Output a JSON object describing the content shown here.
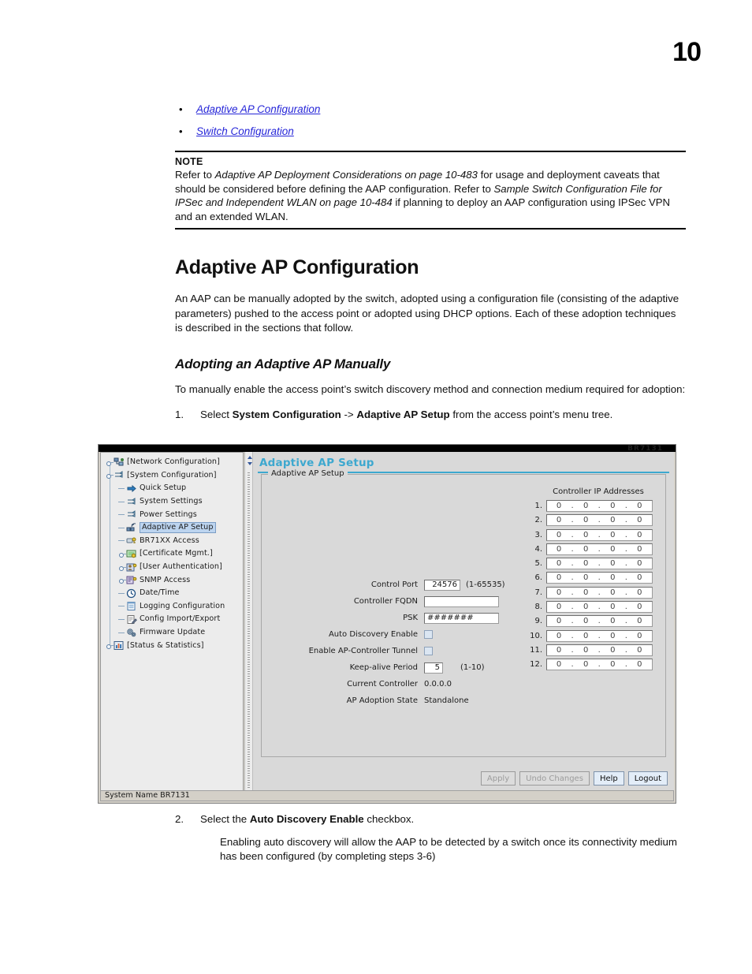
{
  "page": {
    "number": "10"
  },
  "bullets": [
    {
      "label": "Adaptive AP Configuration"
    },
    {
      "label": "Switch Configuration"
    }
  ],
  "note": {
    "title": "NOTE",
    "line1_a": "Refer to ",
    "line1_i": "Adaptive AP Deployment Considerations on page 10-483",
    "line1_b": " for usage and deployment caveats that should be considered before defining the AAP configuration. Refer to ",
    "line2_i": "Sample Switch Configuration File for IPSec and Independent WLAN on page 10-484",
    "line2_b": " if planning to deploy an AAP configuration using IPSec VPN and an extended WLAN."
  },
  "section": {
    "heading": "Adaptive AP Configuration",
    "paragraph": "An AAP can be manually adopted by the switch, adopted using a configuration file (consisting of the adaptive parameters) pushed to the access point or adopted using DHCP options. Each of these adoption techniques is described in the sections that follow.",
    "subheading": "Adopting an Adaptive AP Manually",
    "intro": "To manually enable the access point’s switch discovery method and connection medium required for adoption:"
  },
  "steps": [
    {
      "num": "1.",
      "pre": "Select ",
      "bold1": "System Configuration",
      "mid": " -> ",
      "bold2": "Adaptive AP Setup",
      "post": " from the access point’s menu tree."
    },
    {
      "num": "2.",
      "pre": "Select the ",
      "bold1": "Auto Discovery Enable",
      "post": " checkbox.",
      "sub": "Enabling auto discovery will allow the AAP to be detected by a switch once its connectivity medium has been configured (by completing steps 3-6)"
    }
  ],
  "app": {
    "ghost_logo": "BR7131",
    "pane_title": "Adaptive AP Setup",
    "group_legend": "Adaptive AP Setup",
    "status_bar": "System Name BR7131",
    "tree": [
      {
        "label": "[Network Configuration]",
        "level": 1,
        "handle": "knob",
        "icon": "network-config-icon",
        "selected": false
      },
      {
        "label": "[System Configuration]",
        "level": 1,
        "handle": "knob",
        "icon": "system-config-icon",
        "selected": false
      },
      {
        "label": "Quick Setup",
        "level": 2,
        "handle": "dash",
        "icon": "quick-setup-icon",
        "selected": false
      },
      {
        "label": "System Settings",
        "level": 2,
        "handle": "dash",
        "icon": "system-settings-icon",
        "selected": false
      },
      {
        "label": "Power Settings",
        "level": 2,
        "handle": "dash",
        "icon": "power-settings-icon",
        "selected": false
      },
      {
        "label": "Adaptive AP Setup",
        "level": 2,
        "handle": "dash",
        "icon": "adaptive-ap-icon",
        "selected": true
      },
      {
        "label": "BR71XX Access",
        "level": 2,
        "handle": "dash",
        "icon": "br71xx-access-icon",
        "selected": false
      },
      {
        "label": "[Certificate Mgmt.]",
        "level": 2,
        "handle": "knob",
        "icon": "certificate-icon",
        "selected": false
      },
      {
        "label": "[User Authentication]",
        "level": 2,
        "handle": "knob",
        "icon": "user-auth-icon",
        "selected": false
      },
      {
        "label": "SNMP Access",
        "level": 2,
        "handle": "knob",
        "icon": "snmp-access-icon",
        "selected": false
      },
      {
        "label": "Date/Time",
        "level": 2,
        "handle": "dash",
        "icon": "clock-icon",
        "selected": false
      },
      {
        "label": "Logging Configuration",
        "level": 2,
        "handle": "dash",
        "icon": "logging-icon",
        "selected": false
      },
      {
        "label": "Config Import/Export",
        "level": 2,
        "handle": "dash",
        "icon": "import-export-icon",
        "selected": false
      },
      {
        "label": "Firmware Update",
        "level": 2,
        "handle": "dash",
        "icon": "firmware-icon",
        "selected": false
      },
      {
        "label": "[Status & Statistics]",
        "level": 1,
        "handle": "knob",
        "icon": "status-stats-icon",
        "selected": false
      }
    ],
    "form": {
      "control_port": {
        "label": "Control Port",
        "value": "24576",
        "hint": "(1-65535)"
      },
      "controller_fqdn": {
        "label": "Controller FQDN",
        "value": ""
      },
      "psk": {
        "label": "PSK",
        "value": "#######"
      },
      "auto_discovery": {
        "label": "Auto Discovery Enable",
        "checked": false
      },
      "ap_tunnel": {
        "label": "Enable AP-Controller Tunnel",
        "checked": false
      },
      "keepalive": {
        "label": "Keep-alive Period",
        "value": "5",
        "hint": "(1-10)"
      },
      "current_controller": {
        "label": "Current Controller",
        "value": "0.0.0.0"
      },
      "adoption_state": {
        "label": "AP Adoption State",
        "value": "Standalone"
      }
    },
    "ip_section": {
      "heading": "Controller IP Addresses",
      "rows": [
        {
          "idx": "1.",
          "o1": "0",
          "o2": "0",
          "o3": "0",
          "o4": "0"
        },
        {
          "idx": "2.",
          "o1": "0",
          "o2": "0",
          "o3": "0",
          "o4": "0"
        },
        {
          "idx": "3.",
          "o1": "0",
          "o2": "0",
          "o3": "0",
          "o4": "0"
        },
        {
          "idx": "4.",
          "o1": "0",
          "o2": "0",
          "o3": "0",
          "o4": "0"
        },
        {
          "idx": "5.",
          "o1": "0",
          "o2": "0",
          "o3": "0",
          "o4": "0"
        },
        {
          "idx": "6.",
          "o1": "0",
          "o2": "0",
          "o3": "0",
          "o4": "0"
        },
        {
          "idx": "7.",
          "o1": "0",
          "o2": "0",
          "o3": "0",
          "o4": "0"
        },
        {
          "idx": "8.",
          "o1": "0",
          "o2": "0",
          "o3": "0",
          "o4": "0"
        },
        {
          "idx": "9.",
          "o1": "0",
          "o2": "0",
          "o3": "0",
          "o4": "0"
        },
        {
          "idx": "10.",
          "o1": "0",
          "o2": "0",
          "o3": "0",
          "o4": "0"
        },
        {
          "idx": "11.",
          "o1": "0",
          "o2": "0",
          "o3": "0",
          "o4": "0"
        },
        {
          "idx": "12.",
          "o1": "0",
          "o2": "0",
          "o3": "0",
          "o4": "0"
        }
      ]
    },
    "buttons": {
      "apply": "Apply",
      "undo": "Undo Changes",
      "help": "Help",
      "logout": "Logout"
    }
  },
  "colors": {
    "link": "#2626d8",
    "pane_title": "#3da8cf",
    "selection": "#bcd4ef"
  }
}
